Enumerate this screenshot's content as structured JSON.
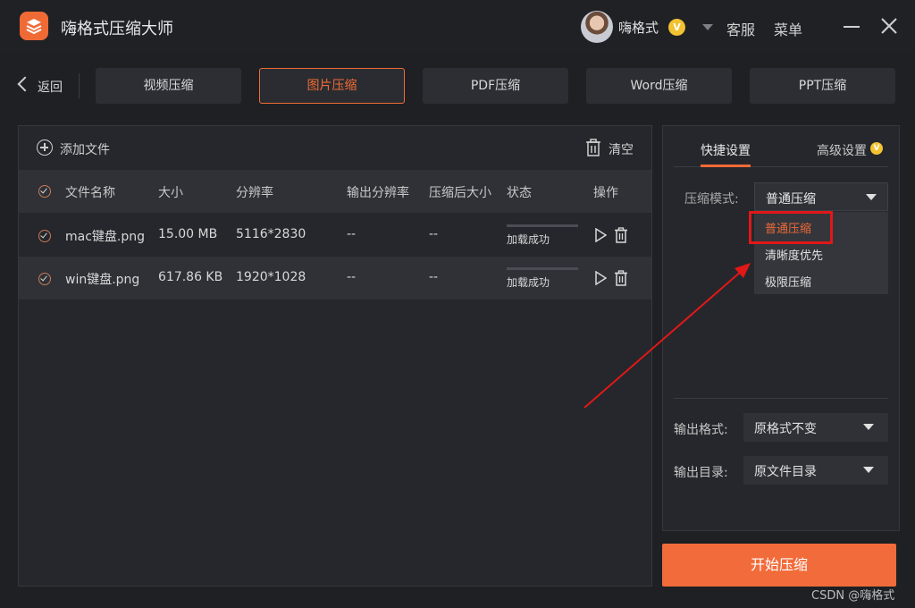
{
  "app": {
    "title": "嗨格式压缩大师"
  },
  "user": {
    "name": "嗨格式",
    "vip_badge": "V"
  },
  "header": {
    "service": "客服",
    "menu": "菜单"
  },
  "nav": {
    "back": "返回",
    "tabs": [
      {
        "label": "视频压缩",
        "active": false
      },
      {
        "label": "图片压缩",
        "active": true
      },
      {
        "label": "PDF压缩",
        "active": false
      },
      {
        "label": "Word压缩",
        "active": false
      },
      {
        "label": "PPT压缩",
        "active": false
      }
    ]
  },
  "filepanel": {
    "add_label": "添加文件",
    "clear_label": "清空",
    "columns": [
      "文件名称",
      "大小",
      "分辨率",
      "输出分辨率",
      "压缩后大小",
      "状态",
      "操作"
    ],
    "rows": [
      {
        "name": "mac键盘.png",
        "size": "15.00 MB",
        "resolution": "5116*2830",
        "out_resolution": "--",
        "out_size": "--",
        "status": "加载成功"
      },
      {
        "name": "win键盘.png",
        "size": "617.86 KB",
        "resolution": "1920*1028",
        "out_resolution": "--",
        "out_size": "--",
        "status": "加载成功"
      }
    ]
  },
  "settings": {
    "tab_quick": "快捷设置",
    "tab_advanced": "高级设置",
    "advanced_badge": "V",
    "mode_label": "压缩模式:",
    "mode_value": "普通压缩",
    "mode_options": [
      "普通压缩",
      "清晰度优先",
      "极限压缩"
    ],
    "format_label": "输出格式:",
    "format_value": "原格式不变",
    "dir_label": "输出目录:",
    "dir_value": "原文件目录"
  },
  "start_button": "开始压缩",
  "watermark": "CSDN @嗨格式",
  "colors": {
    "accent": "#f06a35",
    "highlight": "#e01818",
    "background": "#1e2024"
  }
}
